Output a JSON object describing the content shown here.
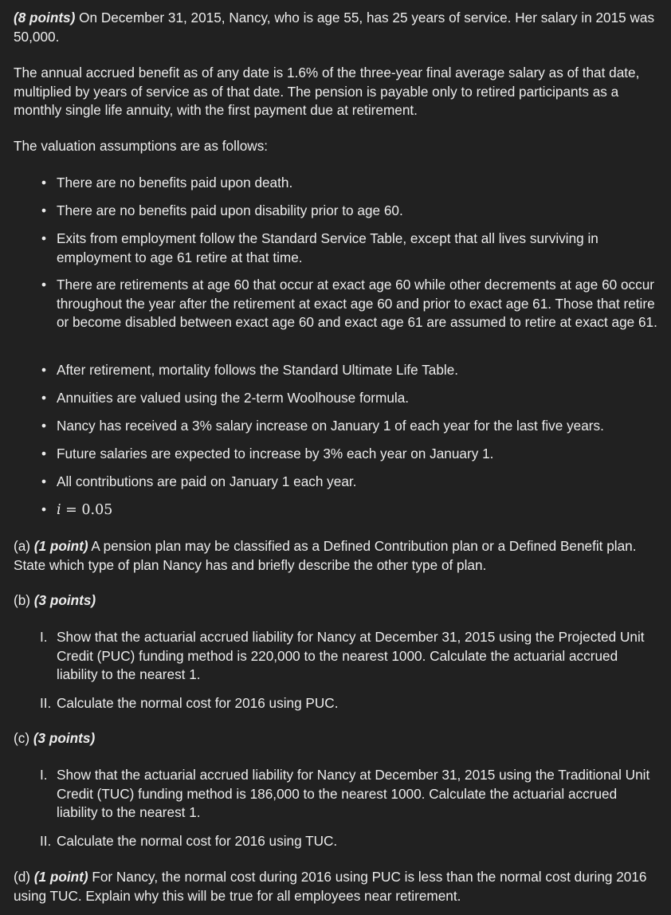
{
  "intro": {
    "points": "(8 points)",
    "text": " On December 31, 2015, Nancy, who is age 55, has 25 years of service. Her salary in 2015 was 50,000."
  },
  "benefit_text": "The annual accrued benefit as of any date is 1.6% of the three-year final average salary as of that date, multiplied by years of service as of that date. The pension is payable only to retired participants as a monthly single life annuity, with the first payment due at retirement.",
  "assumptions": {
    "heading": "The valuation assumptions are as follows:",
    "bullet_glyph": "•",
    "items": [
      "There are no benefits paid upon death.",
      "There are no benefits paid upon disability prior to age 60.",
      "Exits from employment follow the Standard Service Table, except that all lives surviving in employment to age 61 retire at that time.",
      "There are retirements at age 60 that occur at exact age 60 while other decrements at age 60 occur throughout the year after the retirement at exact age 60 and prior to exact age 61. Those that retire or become disabled between exact age 60 and exact age 61 are assumed to retire at exact age 61.",
      "After retirement, mortality follows the Standard Ultimate Life Table.",
      "Annuities are valued using the 2-term Woolhouse formula.",
      "Nancy has received a 3% salary increase on January 1 of each year for the last five years.",
      "Future salaries are expected to increase by 3% each year on January 1.",
      "All contributions are paid on January 1 each year."
    ],
    "math_item": {
      "var": "i",
      "op": " = ",
      "value": "0.05"
    }
  },
  "part_a": {
    "label": "(a) ",
    "points": "(1 point)",
    "text": " A pension plan may be classified as a Defined Contribution plan or a Defined Benefit plan. State which type of plan Nancy has and briefly describe the other type of plan."
  },
  "part_b": {
    "label": "(b) ",
    "points": "(3 points)",
    "items": [
      {
        "num": "I.",
        "text": "Show that the actuarial accrued liability for Nancy at December 31, 2015 using the Projected Unit Credit (PUC) funding method is 220,000 to the nearest 1000. Calculate the actuarial accrued liability to the nearest 1."
      },
      {
        "num": "II.",
        "text": "Calculate the normal cost for 2016 using PUC."
      }
    ]
  },
  "part_c": {
    "label": "(c) ",
    "points": "(3 points)",
    "items": [
      {
        "num": "I.",
        "text": "Show that the actuarial accrued liability for Nancy at December 31, 2015 using the Traditional Unit Credit (TUC) funding method is 186,000 to the nearest 1000. Calculate the actuarial accrued liability to the nearest 1."
      },
      {
        "num": "II.",
        "text": "Calculate the normal cost for 2016 using TUC."
      }
    ]
  },
  "part_d": {
    "label": "(d) ",
    "points": "(1 point)",
    "text": " For Nancy, the normal cost during 2016 using PUC is less than the normal cost during 2016 using TUC. Explain why this will be true for all employees near retirement."
  },
  "colors": {
    "background": "#212121",
    "text": "#ececec"
  }
}
